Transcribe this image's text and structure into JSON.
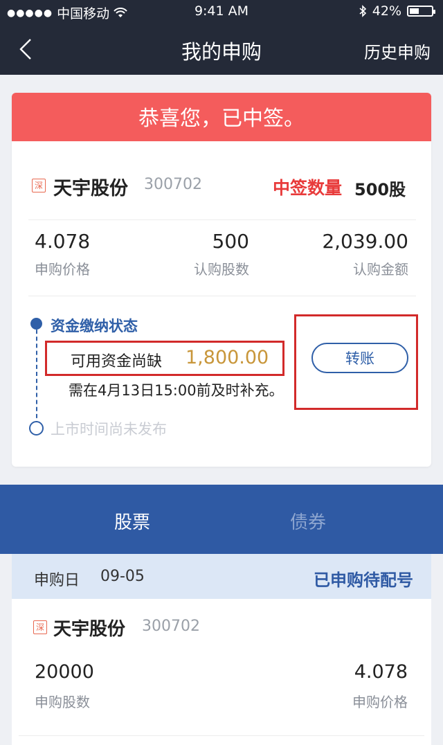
{
  "status_bar": {
    "carrier": "中国移动",
    "time": "9:41 AM",
    "battery": "42%",
    "battery_level": 0.42
  },
  "nav": {
    "title": "我的申购",
    "right_link": "历史申购",
    "back_icon": "chevron-left-icon"
  },
  "result_card": {
    "banner": "恭喜您，已中签。",
    "market_badge": "深",
    "stock_name": "天宇股份",
    "stock_code": "300702",
    "win_label": "中签数量",
    "win_value": "500股",
    "stats": [
      {
        "value": "4.078",
        "label": "申购价格"
      },
      {
        "value": "500",
        "label": "认购股数"
      },
      {
        "value": "2,039.00",
        "label": "认购金额"
      }
    ],
    "timeline": {
      "step1_title": "资金缴纳状态",
      "shortfall_label": "可用资金尚缺",
      "shortfall_value": "1,800.00",
      "deadline_text": "需在4月13日15:00前及时补充。",
      "step2_title": "上市时间尚未发布"
    },
    "transfer_button": "转账"
  },
  "tabs": [
    {
      "label": "股票",
      "active": true
    },
    {
      "label": "债券",
      "active": false
    }
  ],
  "subscription_list": [
    {
      "date_label": "申购日",
      "date": "09-05",
      "status": "已申购待配号",
      "market_badge": "深",
      "stock_name": "天宇股份",
      "stock_code": "300702",
      "shares": "20000",
      "shares_label": "申购股数",
      "price": "4.078",
      "price_label": "申购价格"
    }
  ],
  "colors": {
    "nav_bg": "#242a38",
    "banner": "#f45c5c",
    "accent_blue": "#2f5aa4",
    "win_red": "#e83b3b",
    "amount_gold": "#c8963a",
    "highlight_border": "#d22a2a"
  }
}
